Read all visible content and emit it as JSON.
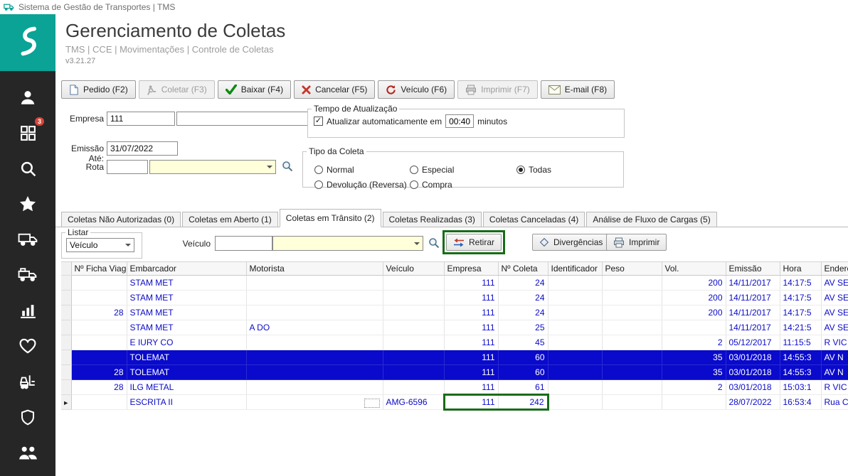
{
  "titlebar": {
    "title": "Sistema de Gestão de Transportes | TMS"
  },
  "header": {
    "title": "Gerenciamento de Coletas",
    "breadcrumb": "TMS | CCE | Movimentações | Controle de Coletas",
    "version": "v3.21.27"
  },
  "colors": {
    "accent_teal": "#0aa396",
    "sidebar_dark": "#262626",
    "selection_blue": "#0a0acc",
    "data_blue": "#0b0bc8",
    "highlight_green": "#176d17",
    "badge_red": "#d8453a",
    "combo_cream": "#ffffd9"
  },
  "sidebar": {
    "items": [
      {
        "icon": "user",
        "badge": null
      },
      {
        "icon": "apps",
        "badge": "3"
      },
      {
        "icon": "search",
        "badge": null
      },
      {
        "icon": "star",
        "badge": null
      },
      {
        "icon": "truck",
        "badge": null
      },
      {
        "icon": "truck-alt",
        "badge": null
      },
      {
        "icon": "chart",
        "badge": null
      },
      {
        "icon": "heart",
        "badge": null
      },
      {
        "icon": "forklift",
        "badge": null
      },
      {
        "icon": "shield",
        "badge": null
      },
      {
        "icon": "group",
        "badge": null
      }
    ]
  },
  "toolbar": {
    "buttons": [
      {
        "label": "Pedido (F2)",
        "icon": "document",
        "enabled": true
      },
      {
        "label": "Coletar (F3)",
        "icon": "collect",
        "enabled": false
      },
      {
        "label": "Baixar (F4)",
        "icon": "check",
        "enabled": true
      },
      {
        "label": "Cancelar (F5)",
        "icon": "cancel",
        "enabled": true
      },
      {
        "label": "Veículo (F6)",
        "icon": "reload",
        "enabled": true
      },
      {
        "label": "Imprimir (F7)",
        "icon": "printer-gray",
        "enabled": false
      },
      {
        "label": "E-mail (F8)",
        "icon": "email",
        "enabled": true
      }
    ]
  },
  "filters": {
    "empresa": {
      "label": "Empresa",
      "value": "111",
      "combo_value": ""
    },
    "emissao": {
      "label": "Emissão Até:",
      "value": "31/07/2022"
    },
    "rota": {
      "label": "Rota",
      "value": "",
      "combo_value": ""
    },
    "tempo_group": {
      "title": "Tempo de Atualização",
      "checkbox_label": "Atualizar automaticamente em",
      "checked": true,
      "value": "00:40",
      "suffix": "minutos"
    },
    "tipo_group": {
      "title": "Tipo da Coleta",
      "options": [
        {
          "label": "Normal",
          "selected": false
        },
        {
          "label": "Especial",
          "selected": false
        },
        {
          "label": "Todas",
          "selected": true
        },
        {
          "label": "Devolução (Reversa)",
          "selected": false
        },
        {
          "label": "Compra",
          "selected": false
        }
      ]
    }
  },
  "tabs": [
    {
      "label": "Coletas Não Autorizadas (0)",
      "active": false
    },
    {
      "label": "Coletas em Aberto (1)",
      "active": false
    },
    {
      "label": "Coletas em Trânsito (2)",
      "active": true
    },
    {
      "label": "Coletas Realizadas (3)",
      "active": false
    },
    {
      "label": "Coletas Canceladas (4)",
      "active": false
    },
    {
      "label": "Análise de Fluxo de Cargas (5)",
      "active": false
    }
  ],
  "listbar": {
    "listar_label": "Listar",
    "listar_value": "Veículo",
    "veiculo_label": "Veículo",
    "veiculo_value": "",
    "veiculo_combo_value": "",
    "buttons": [
      "Retirar",
      "Divergências",
      "Imprimir"
    ]
  },
  "grid": {
    "selector_width": 14,
    "columns": [
      {
        "label": "Nº Ficha Viagem",
        "width": 78,
        "align": "right"
      },
      {
        "label": "Embarcador",
        "width": 168,
        "align": "left"
      },
      {
        "label": "Motorista",
        "width": 192,
        "align": "left"
      },
      {
        "label": "Veículo",
        "width": 86,
        "align": "left"
      },
      {
        "label": "Empresa",
        "width": 76,
        "align": "right"
      },
      {
        "label": "Nº Coleta",
        "width": 70,
        "align": "right"
      },
      {
        "label": "Identificador",
        "width": 76,
        "align": "left"
      },
      {
        "label": "Peso",
        "width": 84,
        "align": "right"
      },
      {
        "label": "Vol.",
        "width": 90,
        "align": "right"
      },
      {
        "label": "Emissão",
        "width": 76,
        "align": "left"
      },
      {
        "label": "Hora",
        "width": 58,
        "align": "left"
      },
      {
        "label": "Endereço",
        "width": 88,
        "align": "left"
      }
    ],
    "rows": [
      {
        "selected": false,
        "marker": false,
        "cells": [
          "",
          "STAM MET",
          "",
          "",
          "111",
          "24",
          "",
          "",
          "200",
          "14/11/2017",
          "14:17:5",
          "AV SE"
        ]
      },
      {
        "selected": false,
        "marker": false,
        "cells": [
          "",
          "STAM MET",
          "",
          "",
          "111",
          "24",
          "",
          "",
          "200",
          "14/11/2017",
          "14:17:5",
          "AV SE"
        ]
      },
      {
        "selected": false,
        "marker": false,
        "cells": [
          "28",
          "STAM MET",
          "",
          "",
          "111",
          "24",
          "",
          "",
          "200",
          "14/11/2017",
          "14:17:5",
          "AV SE"
        ]
      },
      {
        "selected": false,
        "marker": false,
        "cells": [
          "",
          "STAM MET",
          "A DO",
          "",
          "111",
          "25",
          "",
          "",
          "",
          "14/11/2017",
          "14:21:5",
          "AV SE"
        ]
      },
      {
        "selected": false,
        "marker": false,
        "cells": [
          "",
          "E IURY CO",
          "",
          "",
          "111",
          "45",
          "",
          "",
          "2",
          "05/12/2017",
          "11:15:5",
          "R VIC"
        ]
      },
      {
        "selected": true,
        "marker": false,
        "cells": [
          "",
          "TOLEMAT",
          "",
          "",
          "111",
          "60",
          "",
          "",
          "35",
          "03/01/2018",
          "14:55:3",
          "AV N"
        ]
      },
      {
        "selected": true,
        "marker": false,
        "cells": [
          "28",
          "TOLEMAT",
          "",
          "",
          "111",
          "60",
          "",
          "",
          "35",
          "03/01/2018",
          "14:55:3",
          "AV N"
        ]
      },
      {
        "selected": false,
        "marker": false,
        "cells": [
          "28",
          "ILG METAL",
          "",
          "",
          "111",
          "61",
          "",
          "",
          "2",
          "03/01/2018",
          "15:03:1",
          "R VIC"
        ]
      },
      {
        "selected": false,
        "marker": true,
        "cells": [
          "",
          "ESCRITA II",
          "",
          "AMG-6596",
          "111",
          "242",
          "",
          "",
          "",
          "28/07/2022",
          "16:53:4",
          "Rua C"
        ]
      }
    ]
  },
  "annotations": {
    "retirar_outline": true,
    "grid_highlight": {
      "row": 8,
      "cells": [
        4,
        5
      ]
    },
    "focus_cell": {
      "row": 8,
      "cell": 2
    }
  }
}
